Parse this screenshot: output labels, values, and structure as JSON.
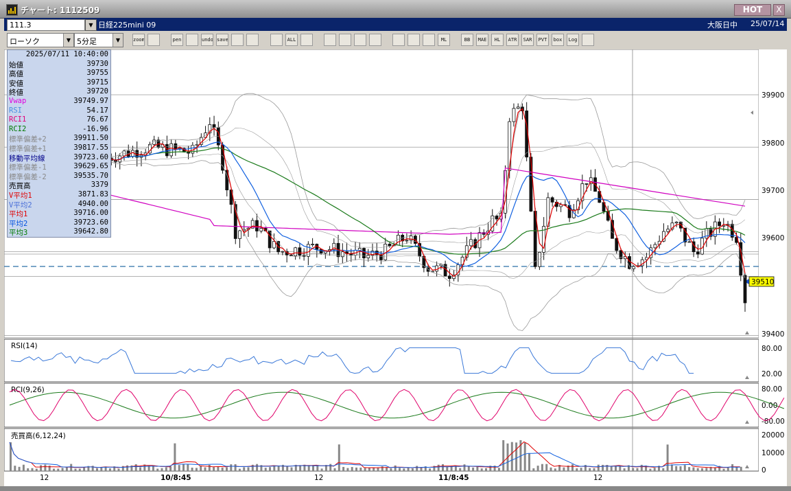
{
  "window": {
    "title": "チャート: 1112509",
    "hot_label": "HOT",
    "close_label": "X"
  },
  "infobar": {
    "code": "111.3",
    "name": "日経225mini 09",
    "market": "大阪日中",
    "date": "25/07/14"
  },
  "toolbar": {
    "chart_type": "ローソク",
    "period": "5分足",
    "buttons": [
      "zoom",
      "window",
      "pen",
      "arrow",
      "undo",
      "save",
      "trash",
      "candle-a",
      "candle-b",
      "ALL",
      "tools",
      "brush",
      "palette",
      "color-a",
      "color-b",
      "color-c",
      "color-d",
      "blank",
      "ML",
      "BB",
      "MAE",
      "HL",
      "ATR",
      "SAR",
      "PVT",
      "box",
      "Log",
      "export"
    ]
  },
  "info_panel": [
    {
      "label": "",
      "value": "2025/07/11 10:40:00",
      "color": "#000000"
    },
    {
      "label": "始値",
      "value": "39730",
      "color": "#000000"
    },
    {
      "label": "高値",
      "value": "39755",
      "color": "#000000"
    },
    {
      "label": "安値",
      "value": "39715",
      "color": "#000000"
    },
    {
      "label": "終値",
      "value": "39720",
      "color": "#000000"
    },
    {
      "label": "Vwap",
      "value": "39749.97",
      "color": "#e000e0"
    },
    {
      "label": "RSI",
      "value": "54.17",
      "color": "#4a90e2"
    },
    {
      "label": "RCI1",
      "value": "76.67",
      "color": "#e0007a"
    },
    {
      "label": "RCI2",
      "value": "-16.96",
      "color": "#007a00"
    },
    {
      "label": "標準偏差+2",
      "value": "39911.50",
      "color": "#888888"
    },
    {
      "label": "標準偏差+1",
      "value": "39817.55",
      "color": "#888888"
    },
    {
      "label": "移動平均線",
      "value": "39723.60",
      "color": "#00008a"
    },
    {
      "label": "標準偏差-1",
      "value": "39629.65",
      "color": "#888888"
    },
    {
      "label": "標準偏差-2",
      "value": "39535.70",
      "color": "#888888"
    },
    {
      "label": "売買高",
      "value": "3379",
      "color": "#000000"
    },
    {
      "label": "V平均1",
      "value": "3871.83",
      "color": "#e00000"
    },
    {
      "label": "V平均2",
      "value": "4940.00",
      "color": "#4a70d8"
    },
    {
      "label": "平均1",
      "value": "39716.00",
      "color": "#e00000"
    },
    {
      "label": "平均2",
      "value": "39723.60",
      "color": "#0050e0"
    },
    {
      "label": "平均3",
      "value": "39642.80",
      "color": "#007a00"
    }
  ],
  "price_axis": {
    "ticks": [
      "39900",
      "39800",
      "39700",
      "39600",
      "39400"
    ],
    "current_price": "39510"
  },
  "panels": {
    "rsi": {
      "title": "RSI(14)",
      "ticks": [
        "80.00",
        "20.00"
      ]
    },
    "rci": {
      "title": "RCI(9,26)",
      "ticks": [
        "80.00",
        "0.00",
        "-80.00"
      ]
    },
    "volume": {
      "title": "売買高(6,12,24)",
      "ticks": [
        "20000",
        "10000",
        "0"
      ]
    }
  },
  "x_axis": {
    "labels": [
      "12",
      "10/8:45",
      "12",
      "11/8:45",
      "12"
    ]
  },
  "colors": {
    "bg": "#ffffff",
    "up": "#cc0000",
    "down": "#111111",
    "ma1": "#e00000",
    "ma2": "#1060e0",
    "ma3": "#1a7a1a",
    "vwap": "#d000c0",
    "band": "#9a9a9a",
    "rsi": "#3a78d8",
    "rci1": "#e0006a",
    "rci2": "#1a7a1a",
    "dashed": "#2a6fa8"
  }
}
